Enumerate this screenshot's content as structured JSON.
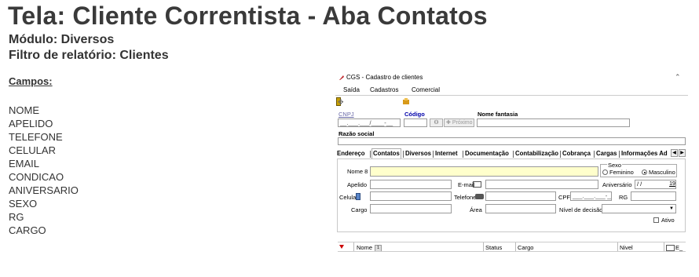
{
  "doc": {
    "title": "Tela: Cliente Correntista - Aba Contatos",
    "module": "Módulo: Diversos",
    "filter": "Filtro de relatório: Clientes",
    "fields_header": "Campos:",
    "fields": [
      "NOME",
      "APELIDO",
      "TELEFONE",
      "CELULAR",
      "EMAIL",
      "CONDICAO",
      "ANIVERSARIO",
      "SEXO",
      "RG",
      "CARGO"
    ]
  },
  "window": {
    "title": "CGS - Cadastro de clientes",
    "menu": {
      "saida": "Saída",
      "cadastros": "Cadastros",
      "comercial": "Comercial"
    },
    "header": {
      "cnpj_label": "CNPJ",
      "cnpj_value": "__.___.___/____-__",
      "codigo_label": "Código",
      "proximo_label": "Próximo",
      "nome_fantasia_label": "Nome fantasia",
      "razao_social_label": "Razão social"
    },
    "tabs": [
      "Endereço",
      "Contatos",
      "Diversos",
      "Internet",
      "Documentação",
      "Contabilização",
      "Cobrança",
      "Cargas",
      "Informações Ad"
    ],
    "active_tab": "Contatos",
    "form": {
      "nome_label": "Nome",
      "nome_marker": "8",
      "sexo_label": "Sexo",
      "feminino_label": "Feminino",
      "masculino_label": "Masculino",
      "sexo_selected": "Masculino",
      "apelido_label": "Apelido",
      "email_label": "E-mail",
      "aniversario_label": "Aniversário",
      "aniversario_value": " / /",
      "celular_label": "Celular",
      "telefone_label": "Telefone",
      "cpf_label": "CPF",
      "cpf_value": "___.___.___-__",
      "rg_label": "RG",
      "cargo_label": "Cargo",
      "area_label": "Área",
      "nivel_label": "Nível de decisão",
      "ativo_label": "Ativo"
    },
    "grid": {
      "columns": [
        "Nome",
        "Status",
        "Cargo",
        "Nivel",
        "E_"
      ],
      "sort_badge": "1"
    }
  }
}
